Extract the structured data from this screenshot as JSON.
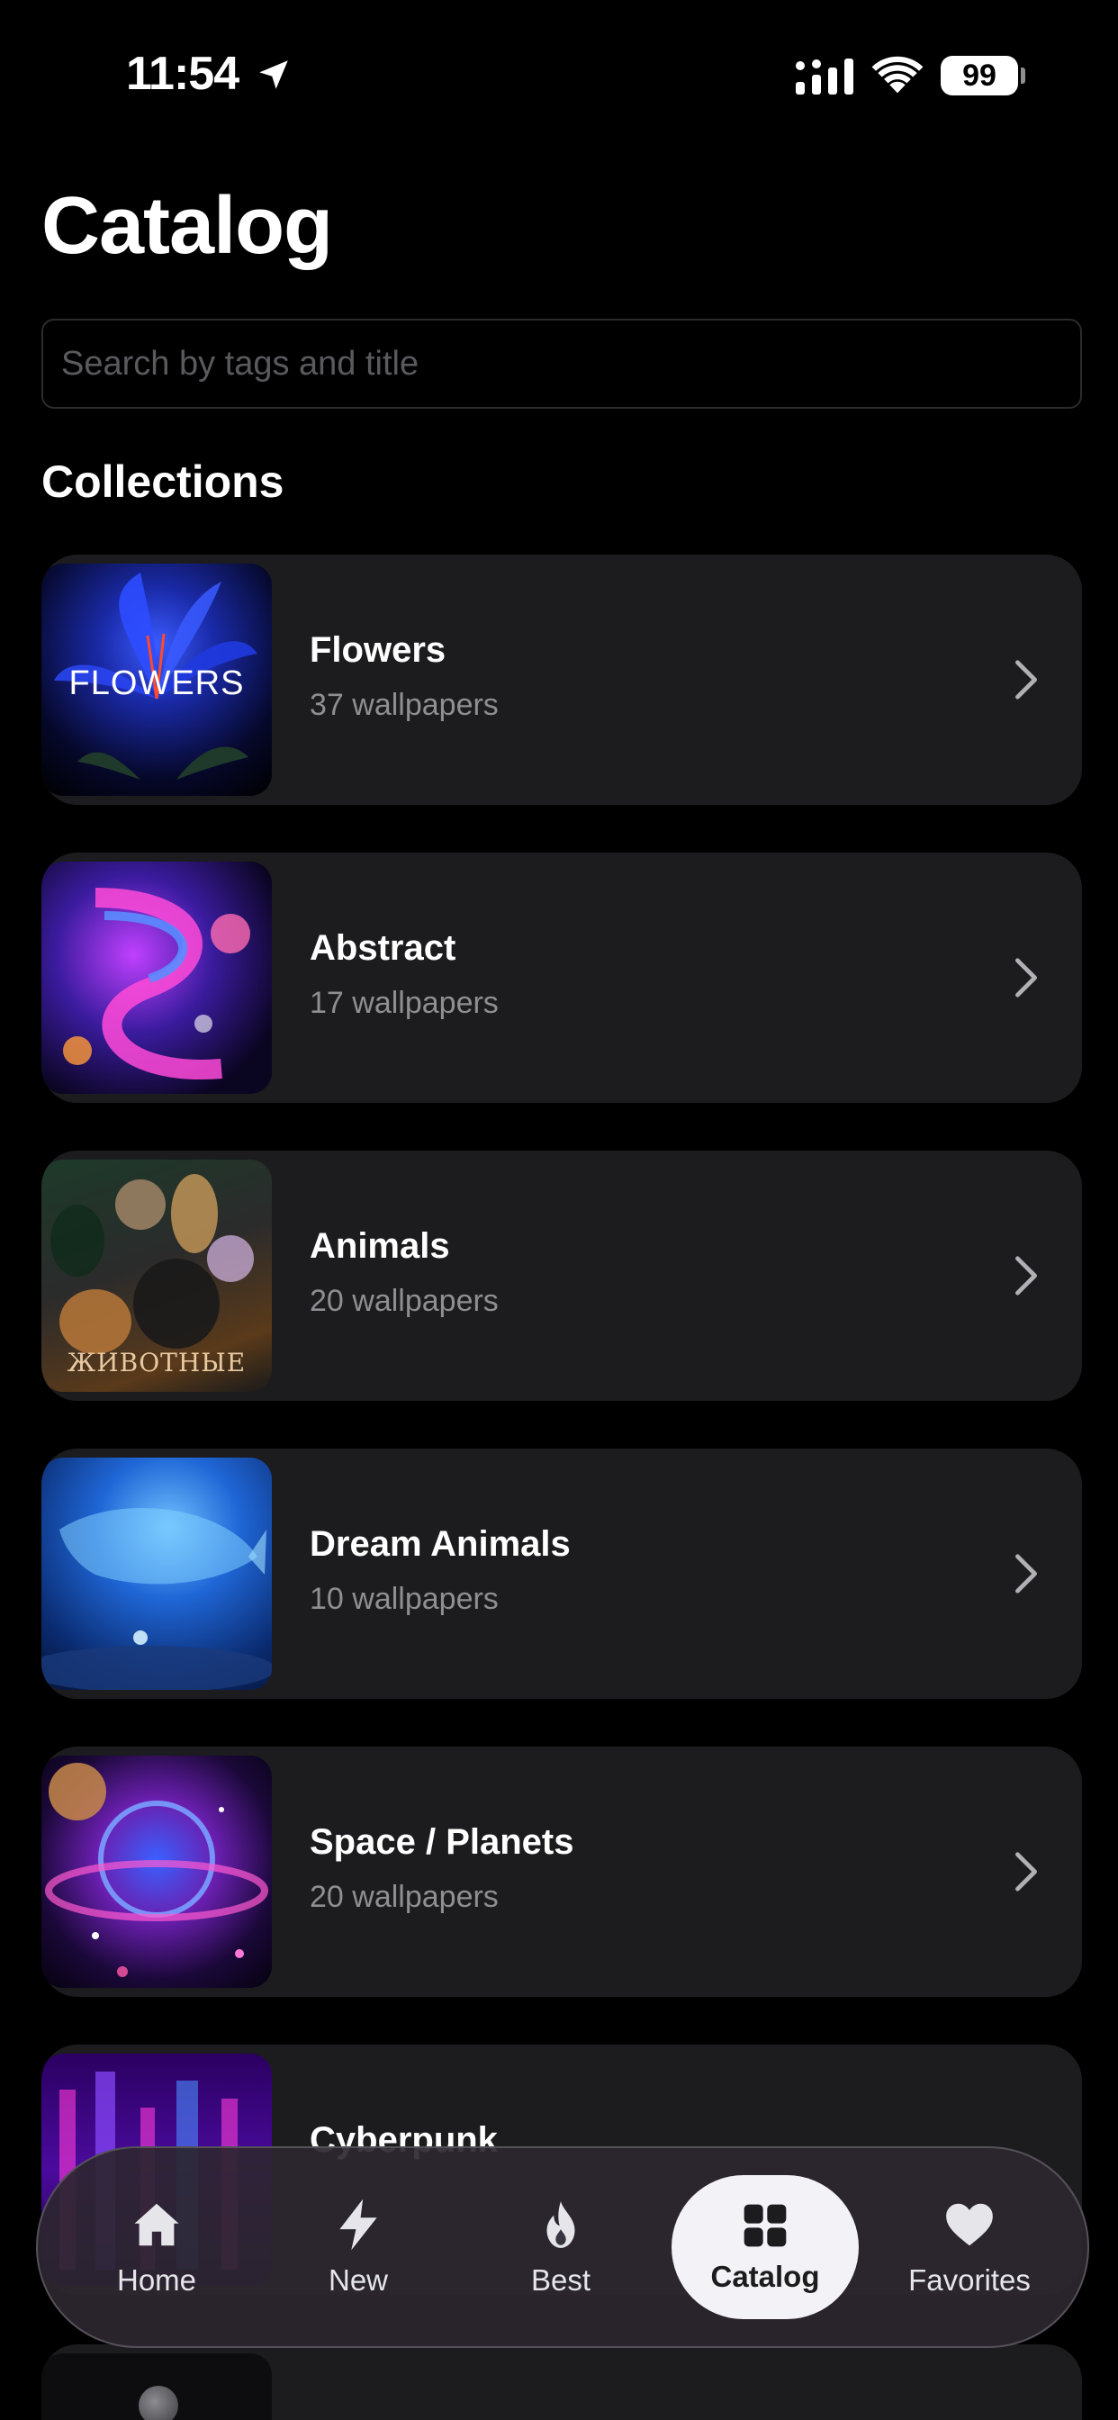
{
  "status_bar": {
    "time": "11:54",
    "battery": "99",
    "icons": [
      "location-arrow-icon",
      "signal-icon",
      "wifi-icon",
      "battery-icon"
    ]
  },
  "page": {
    "title": "Catalog"
  },
  "search": {
    "placeholder": "Search by tags and title",
    "value": ""
  },
  "section": {
    "title": "Collections"
  },
  "collections": [
    {
      "title": "Flowers",
      "count": "37 wallpapers",
      "thumb_text": "FLOWERS"
    },
    {
      "title": "Abstract",
      "count": "17 wallpapers"
    },
    {
      "title": "Animals",
      "count": "20 wallpapers",
      "thumb_text": "ЖИВОТНЫЕ"
    },
    {
      "title": "Dream Animals",
      "count": "10 wallpapers"
    },
    {
      "title": "Space / Planets",
      "count": "20 wallpapers"
    },
    {
      "title": "Cyberpunk",
      "count": ""
    }
  ],
  "tabbar": {
    "tabs": [
      {
        "label": "Home",
        "icon": "home-icon"
      },
      {
        "label": "New",
        "icon": "lightning-icon"
      },
      {
        "label": "Best",
        "icon": "flame-icon"
      },
      {
        "label": "Catalog",
        "icon": "grid-icon",
        "active": true
      },
      {
        "label": "Favorites",
        "icon": "heart-icon"
      }
    ]
  },
  "colors": {
    "background": "#000000",
    "card": "#1c1c1e",
    "secondary_text": "#8e8e93",
    "active_tab": "#f2f2f7"
  }
}
